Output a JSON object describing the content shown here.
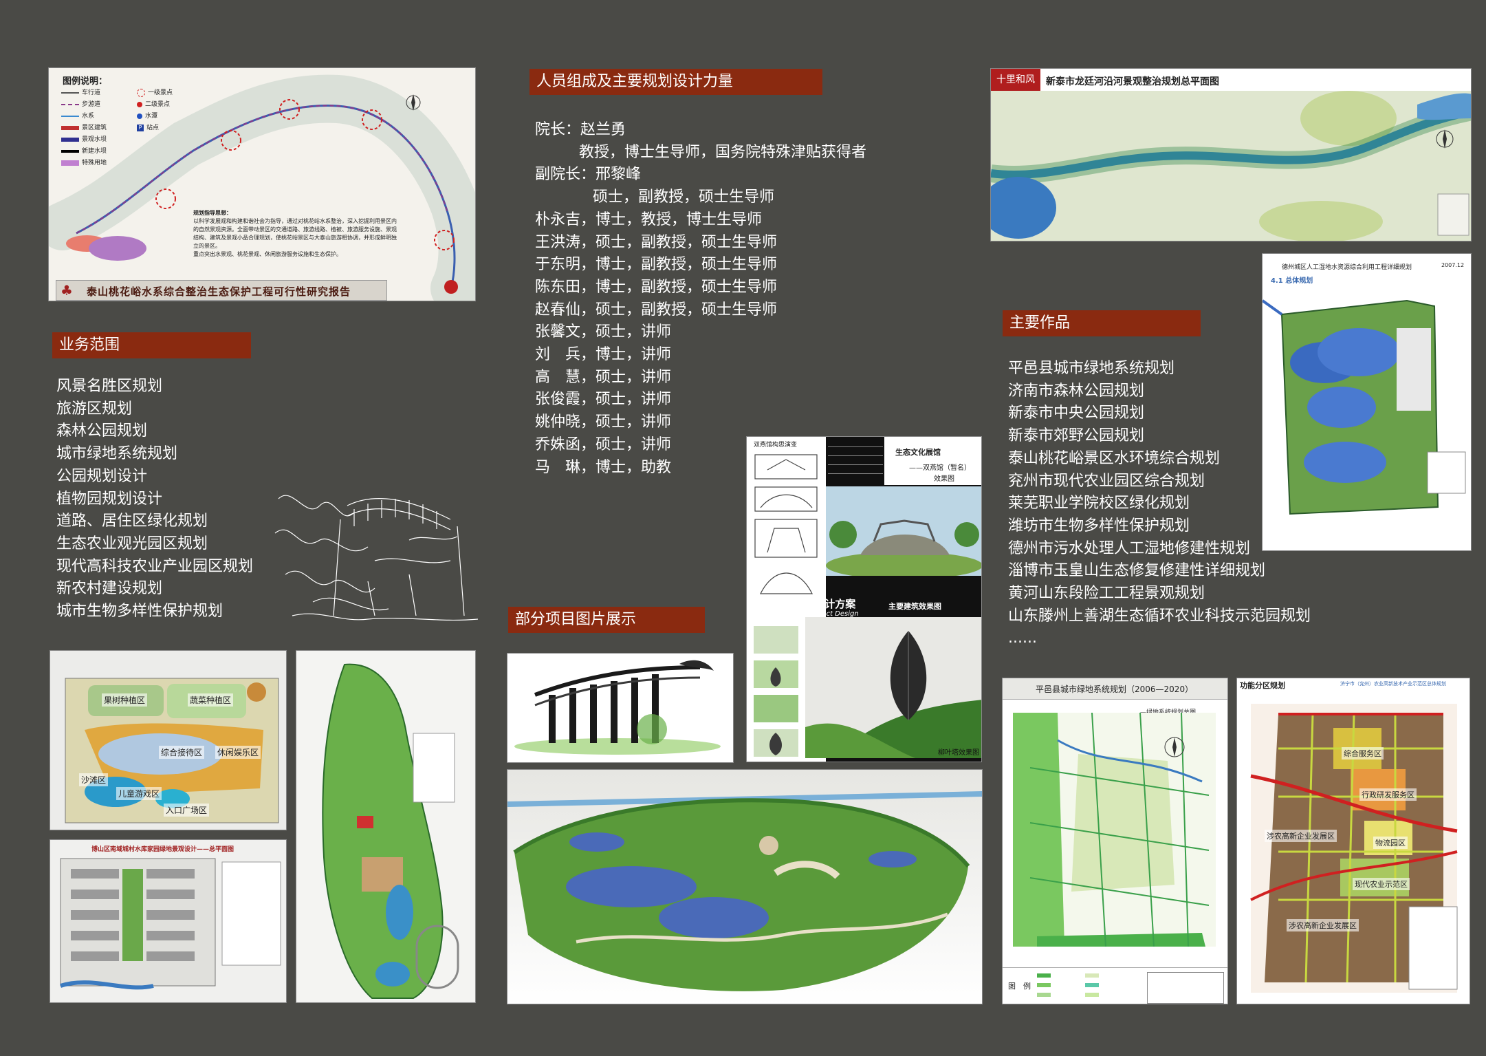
{
  "business": {
    "heading": "业务范围",
    "items": [
      "风景名胜区规划",
      "旅游区规划",
      "森林公园规划",
      "城市绿地系统规划",
      "公园规划设计",
      "植物园规划设计",
      "道路、居住区绿化规划",
      "生态农业观光园区规划",
      "现代高科技农业产业园区规划",
      "新农村建设规划",
      "城市生物多样性保护规划"
    ]
  },
  "staff": {
    "heading": "人员组成及主要规划设计力量",
    "lines": [
      {
        "text": "院长：赵兰勇",
        "indent": 0
      },
      {
        "text": "教授，博士生导师，国务院特殊津贴获得者",
        "indent": 1
      },
      {
        "text": "副院长：邢黎峰",
        "indent": 0
      },
      {
        "text": "硕士，副教授，硕士生导师",
        "indent": 2
      },
      {
        "text": "朴永吉，博士，教授，博士生导师",
        "indent": 0
      },
      {
        "text": "王洪涛，硕士，副教授，硕士生导师",
        "indent": 0
      },
      {
        "text": "于东明，博士，副教授，硕士生导师",
        "indent": 0
      },
      {
        "text": "陈东田，博士，副教授，硕士生导师",
        "indent": 0
      },
      {
        "text": "赵春仙，硕士，副教授，硕士生导师",
        "indent": 0
      },
      {
        "text": "张馨文，硕士，讲师",
        "indent": 0
      },
      {
        "text": "刘　兵，博士，讲师",
        "indent": 0
      },
      {
        "text": "高　慧，硕士，讲师",
        "indent": 0
      },
      {
        "text": "张俊霞，硕士，讲师",
        "indent": 0
      },
      {
        "text": "姚仲晓，硕士，讲师",
        "indent": 0
      },
      {
        "text": "乔姝函，硕士，讲师",
        "indent": 0
      },
      {
        "text": "马　琳，博士，助教",
        "indent": 0
      }
    ]
  },
  "works": {
    "heading": "主要作品",
    "items": [
      "平邑县城市绿地系统规划",
      "济南市森林公园规划",
      "新泰市中央公园规划",
      "新泰市郊野公园规划",
      "泰山桃花峪景区水环境综合规划",
      "兖州市现代农业园区综合规划",
      "莱芜职业学院校区绿化规划",
      "潍坊市生物多样性保护规划",
      "德州市污水处理人工湿地修建性规划",
      "淄博市玉皇山生态修复修建性详细规划",
      "黄河山东段险工工程景观规划",
      "山东滕州上善湖生态循环农业科技示范园规划",
      "......"
    ]
  },
  "projects": {
    "heading": "部分项目图片展示"
  },
  "images": {
    "taishan": {
      "title": "泰山桃花峪水系综合整治生态保护工程可行性研究报告",
      "legend_title": "图例说明：",
      "legend": [
        "车行道",
        "步游道",
        "水系",
        "景区建筑",
        "景观水坝",
        "新建水坝",
        "特殊用地",
        "一级景点",
        "二级景点",
        "水潭",
        "站点"
      ],
      "guide_title": "规划指导思想：",
      "guide_text": "以科学发展观和构建和谐社会为指导，通过对桃花峪水系整治，深入挖掘利用景区内的自然景观资源。全面带动景区的交通道路、旅游线路、植被、旅游服务设施、景观结构、建筑及景观小品合理规划，使桃花峪景区与大泰山旅游相协调，并形成鲜明独立的景区。",
      "guide_text2": "重点突出水景观、桃花景观、休闲旅游服务设施和生态保护。"
    },
    "xintai": {
      "tag": "十里和风",
      "title": "新泰市龙廷河沿河景观整治规划总平面图"
    },
    "dezhou": {
      "title": "德州城区人工湿地水资源综合利用工程详细规划",
      "date": "2007.12",
      "sub": "4.1 总体规划"
    },
    "jinan": {
      "title": "济南森林公园  设计方案",
      "title_en": "Jinan Forest Park  Project Design",
      "label1": "双燕馆构思演变",
      "label2": "生态文化展馆",
      "label3": "——双燕馆（暂名）",
      "label4": "效果图",
      "label5": "主要建筑效果图",
      "label6": "柳叶塔效果图"
    },
    "pingyi": {
      "title": "平邑县城市绿地系统规划（2006—2020）",
      "sub": "—绿地系统规划总图",
      "legend_title": "图　例"
    },
    "jining": {
      "title": "功能分区规划",
      "sub": "济宁市（兖州）农业高新技术产业示范区总体规划",
      "zones": [
        "综合服务区",
        "行政研发服务区",
        "涉农高新企业发展区",
        "物流园区",
        "现代农业示范区",
        "涉农高新企业发展区"
      ]
    },
    "park_plan": {
      "labels": [
        "果树种植区",
        "蔬菜种植区",
        "综合接待区",
        "休闲娱乐区",
        "沙滩区",
        "儿童游戏区",
        "入口广场区"
      ]
    },
    "residential": {
      "title": "博山区南域城村水库家园绿地景观设计——总平面图"
    }
  },
  "colors": {
    "background": "#4a4a46",
    "heading_bar": "#8a2a10"
  }
}
